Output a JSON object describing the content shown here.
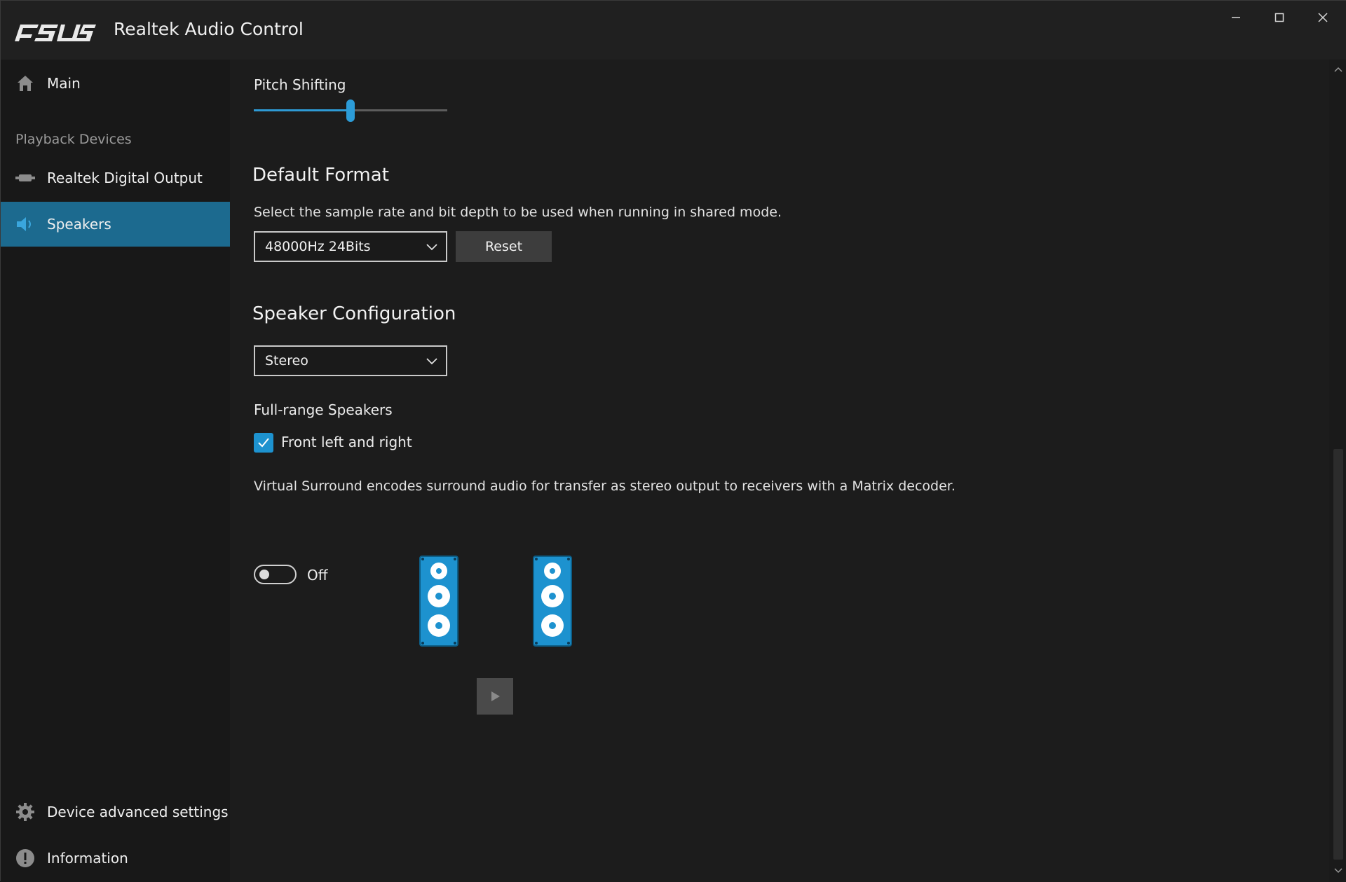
{
  "window": {
    "logo_text": "ASUS",
    "title": "Realtek Audio Control",
    "controls": {
      "minimize": "minimize-icon",
      "maximize": "maximize-icon",
      "close": "close-icon"
    }
  },
  "sidebar": {
    "main_label": "Main",
    "section_label": "Playback Devices",
    "items": [
      {
        "label": "Realtek Digital Output",
        "icon": "digital-output-icon",
        "active": false
      },
      {
        "label": "Speakers",
        "icon": "speaker-icon",
        "active": true
      }
    ],
    "advanced_label": "Device advanced settings",
    "info_label": "Information"
  },
  "content": {
    "pitch": {
      "label": "Pitch Shifting",
      "value_fraction": 0.5
    },
    "default_format": {
      "title": "Default Format",
      "description": "Select the sample rate and bit depth to be used when running in shared mode.",
      "selected": "48000Hz 24Bits",
      "reset_label": "Reset"
    },
    "speaker_config": {
      "title": "Speaker Configuration",
      "selected": "Stereo"
    },
    "full_range": {
      "title": "Full-range Speakers",
      "checkbox_label": "Front left and right",
      "checked": true
    },
    "virtual_surround": {
      "description": "Virtual Surround encodes surround audio for transfer as stereo output to receivers with a Matrix decoder.",
      "state_label": "Off",
      "enabled": false
    }
  },
  "colors": {
    "accent": "#1d92cf",
    "active_nav": "#1c6a8f",
    "background": "#1c1c1c",
    "sidebar": "#181818",
    "titlebar": "#202020"
  }
}
